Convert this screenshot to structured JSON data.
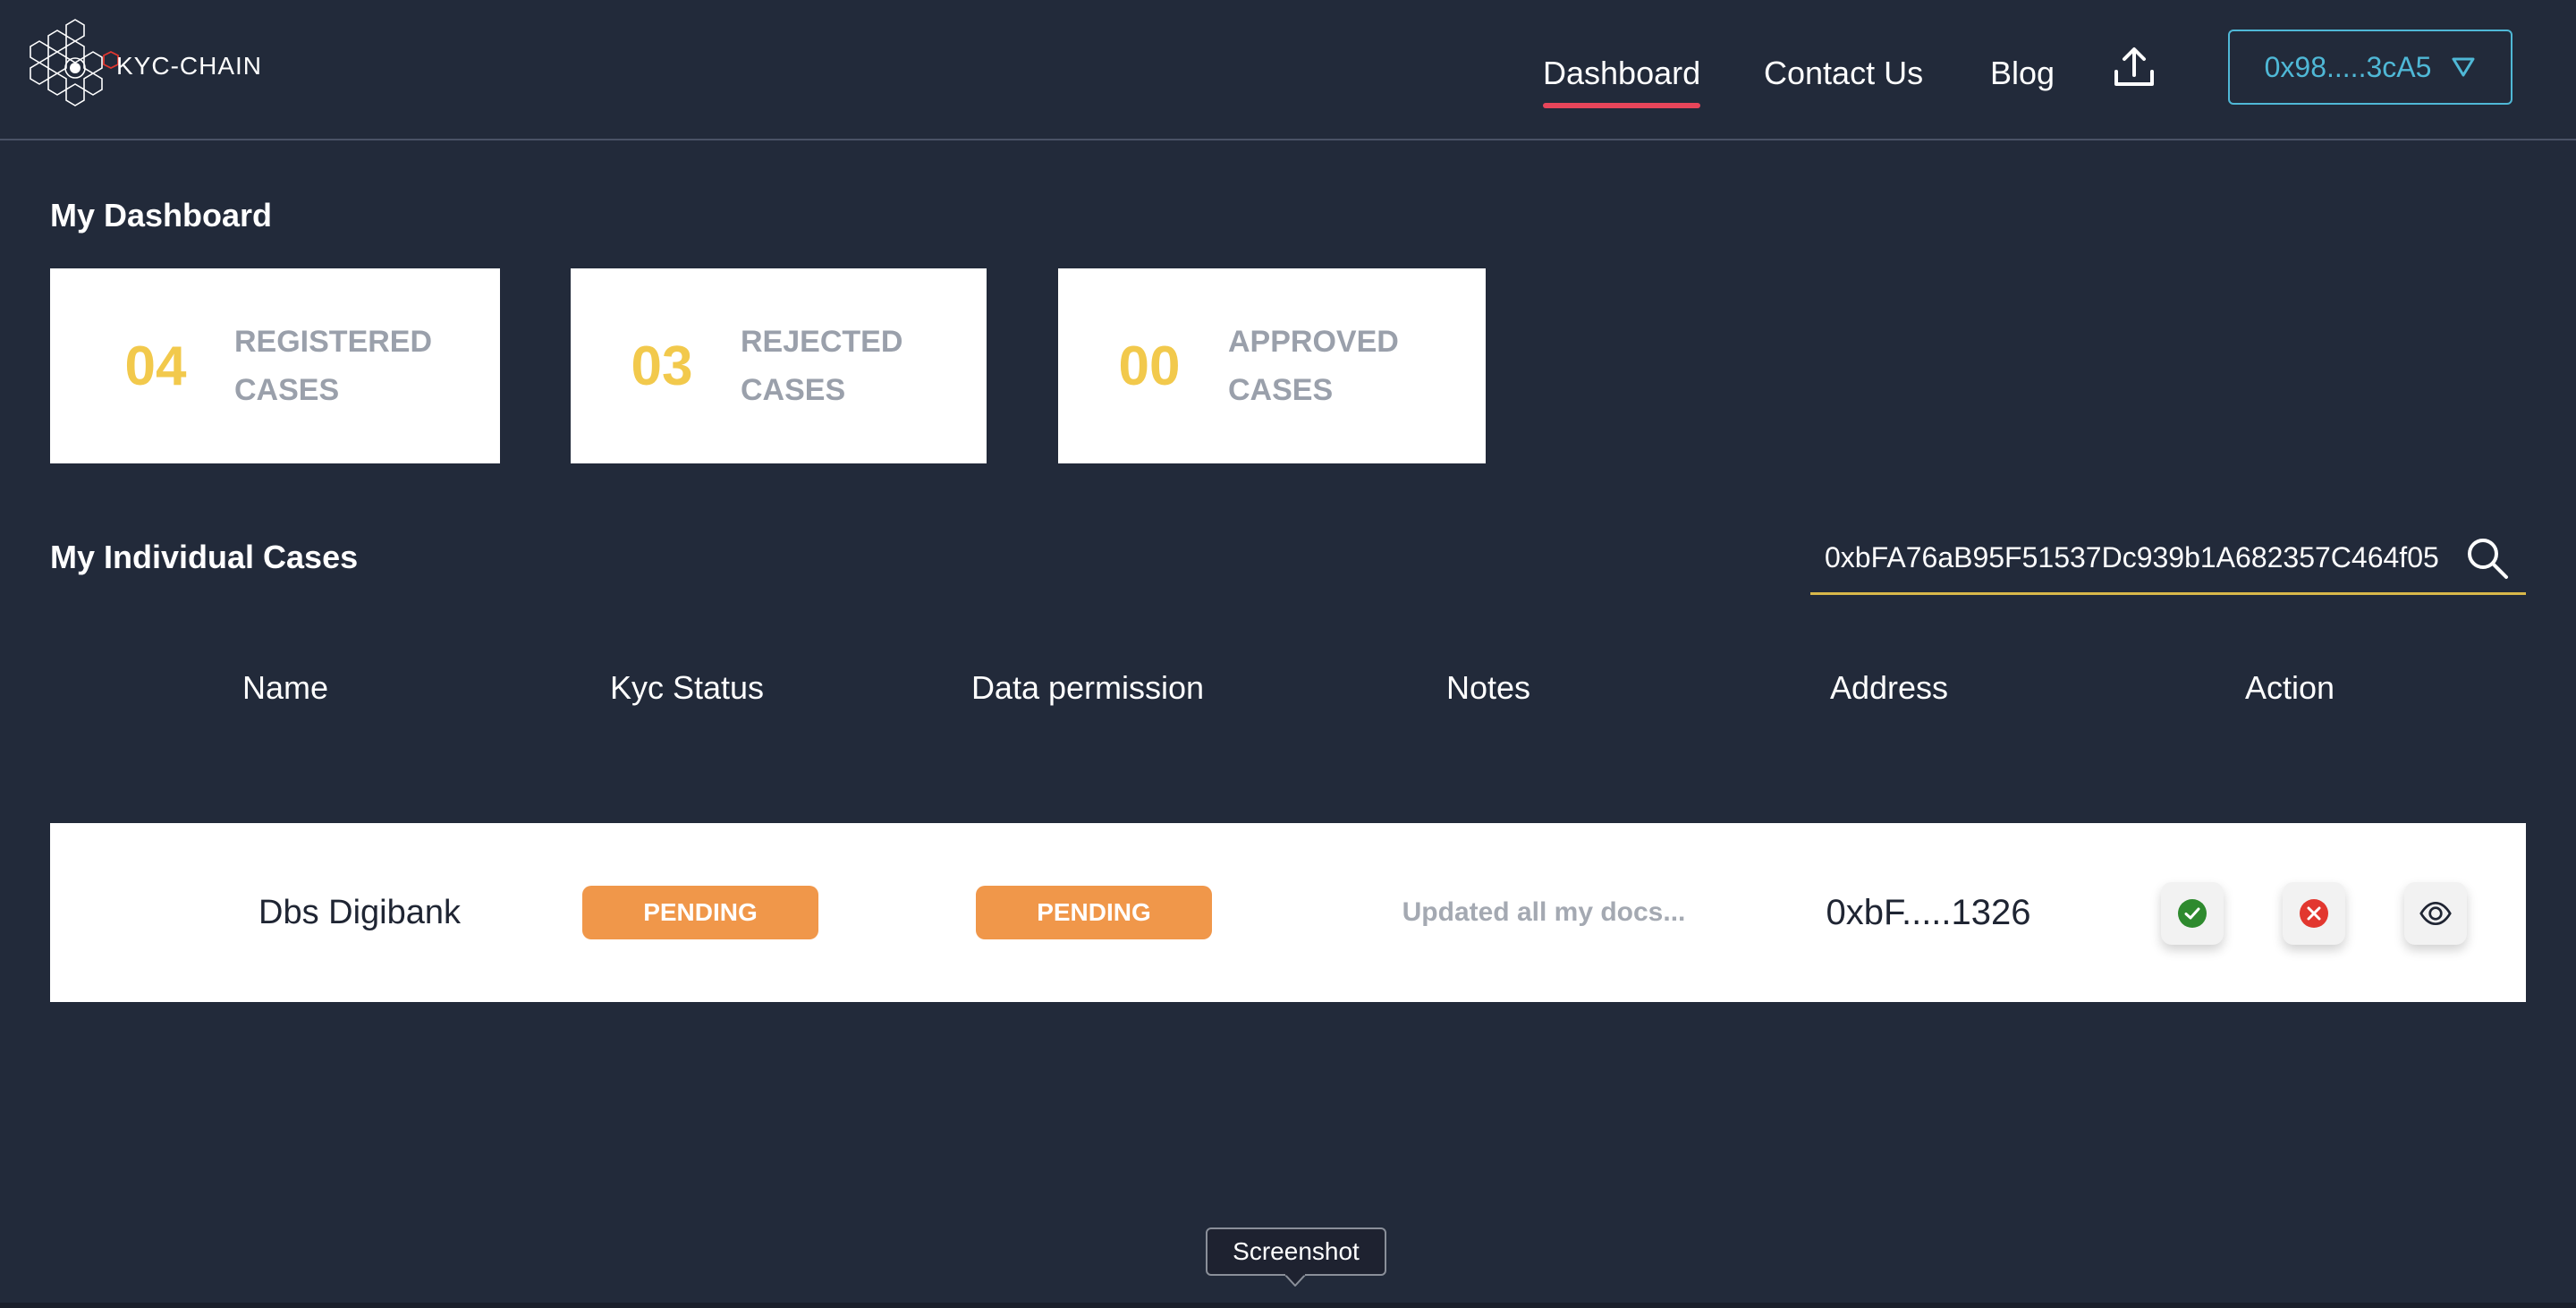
{
  "brand": {
    "name": "KYC-CHAIN"
  },
  "nav": {
    "dashboard": "Dashboard",
    "contact": "Contact Us",
    "blog": "Blog",
    "upload_icon": "upload-icon",
    "wallet_address": "0x98.....3cA5"
  },
  "dashboard": {
    "title": "My Dashboard",
    "cards": [
      {
        "count": "04",
        "label_line1": "REGISTERED",
        "label_line2": "CASES"
      },
      {
        "count": "03",
        "label_line1": "REJECTED",
        "label_line2": "CASES"
      },
      {
        "count": "00",
        "label_line1": "APPROVED",
        "label_line2": "CASES"
      }
    ]
  },
  "cases": {
    "title": "My Individual Cases",
    "search_value": "0xbFA76aB95F51537Dc939b1A682357C464f05",
    "columns": [
      "Name",
      "Kyc Status",
      "Data permission",
      "Notes",
      "Address",
      "Action"
    ],
    "rows": [
      {
        "name": "Dbs Digibank",
        "kyc_status": "PENDING",
        "data_permission": "PENDING",
        "notes": "Updated all my docs...",
        "address": "0xbF.....1326"
      }
    ]
  },
  "tooltip": {
    "label": "Screenshot"
  },
  "colors": {
    "background": "#222a3a",
    "accent_gold": "#f2c94c",
    "nav_active": "#e8455a",
    "wallet": "#4fb8d6",
    "pending_badge": "#f0974a",
    "approve": "#2e8a2e",
    "reject": "#e2372f"
  }
}
